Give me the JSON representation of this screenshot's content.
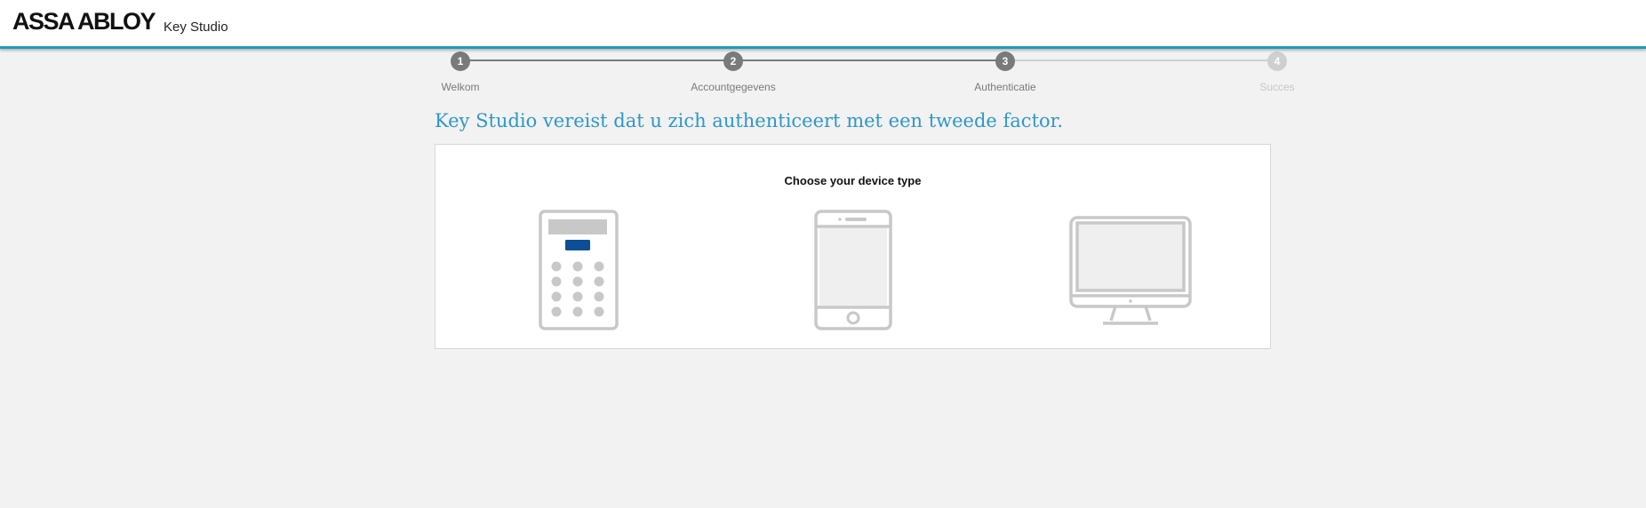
{
  "header": {
    "logo_text": "ASSA ABLOY",
    "product_name": "Key Studio",
    "accent_color": "#1f9bb8"
  },
  "stepper": {
    "steps": [
      {
        "number": "1",
        "label": "Welkom",
        "state": "completed"
      },
      {
        "number": "2",
        "label": "Accountgegevens",
        "state": "completed"
      },
      {
        "number": "3",
        "label": "Authenticatie",
        "state": "active"
      },
      {
        "number": "4",
        "label": "Succes",
        "state": "pending"
      }
    ],
    "completed_color": "#7a7a7a",
    "pending_color": "#cfcfcf"
  },
  "main": {
    "title": "Key Studio vereist dat u zich authenticeert met een tweede factor.",
    "title_color": "#2f98c7",
    "card": {
      "heading": "Choose your device type",
      "devices": [
        {
          "icon": "hardware-token-icon"
        },
        {
          "icon": "smartphone-icon"
        },
        {
          "icon": "desktop-computer-icon"
        }
      ],
      "token_button_color": "#0d4f96",
      "icon_color": "#c8c8c8"
    }
  }
}
